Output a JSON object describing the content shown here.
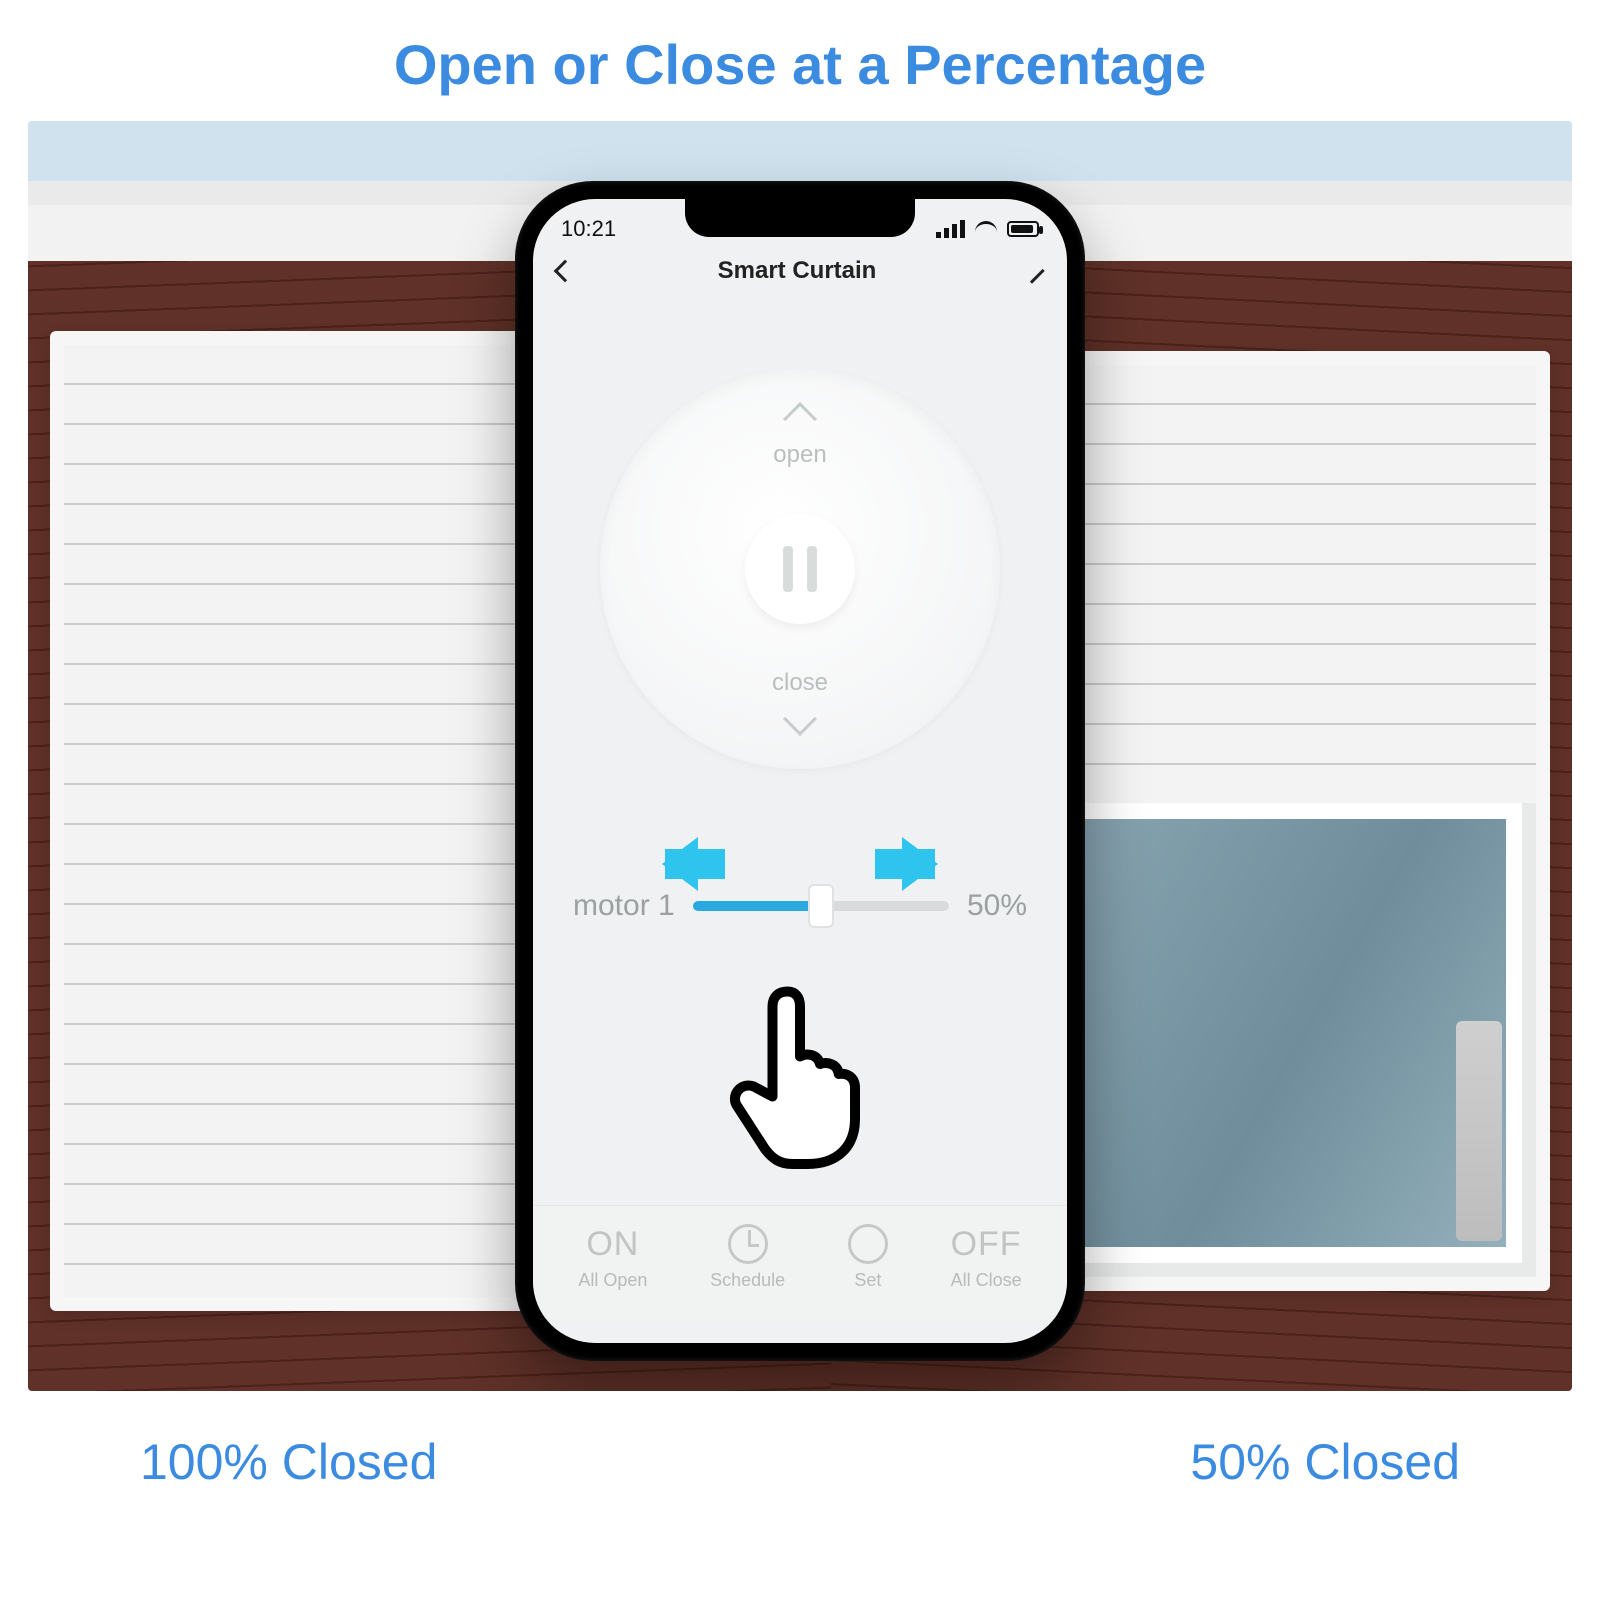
{
  "headline": "Open or Close at a Percentage",
  "captions": {
    "left": "100% Closed",
    "right": "50% Closed"
  },
  "statusbar": {
    "time": "10:21"
  },
  "navbar": {
    "title": "Smart Curtain"
  },
  "dial": {
    "open_label": "open",
    "close_label": "close"
  },
  "slider": {
    "label": "motor 1",
    "value_text": "50%",
    "percent": 50
  },
  "bottombar": {
    "on": "ON",
    "all_open": "All Open",
    "schedule": "Schedule",
    "set": "Set",
    "off": "OFF",
    "all_close": "All Close"
  }
}
